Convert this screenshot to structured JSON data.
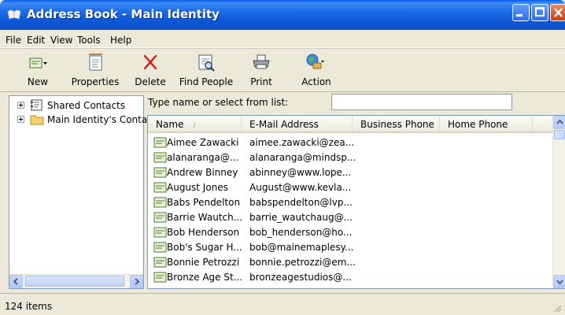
{
  "window": {
    "title": "Address Book - Main Identity"
  },
  "menu": [
    "File",
    "Edit",
    "View",
    "Tools",
    "Help"
  ],
  "toolbar": {
    "new": "New",
    "properties": "Properties",
    "delete": "Delete",
    "find_people": "Find People",
    "print": "Print",
    "action": "Action"
  },
  "tree": {
    "items": [
      {
        "label": "Shared Contacts",
        "icon": "shared-contacts-icon"
      },
      {
        "label": "Main Identity's Conta",
        "icon": "folder-icon"
      }
    ]
  },
  "search": {
    "label": "Type name or select from list:",
    "value": ""
  },
  "list": {
    "columns": [
      "Name",
      "E-Mail Address",
      "Business Phone",
      "Home Phone"
    ],
    "sort_indicator": "/",
    "rows": [
      {
        "name": "Aimee Zawacki",
        "email": "aimee.zawacki@zea..."
      },
      {
        "name": "alanaranga@...",
        "email": "alanaranga@mindsp..."
      },
      {
        "name": "Andrew Binney",
        "email": "abinney@www.lope..."
      },
      {
        "name": "August Jones",
        "email": "August@www.kevla..."
      },
      {
        "name": "Babs Pendelton",
        "email": "babspendelton@lvp..."
      },
      {
        "name": "Barrie Wautch...",
        "email": "barrie_wautchaug@..."
      },
      {
        "name": "Bob Henderson",
        "email": "bob_henderson@ho..."
      },
      {
        "name": "Bob's Sugar H...",
        "email": "bob@mainemaplesy..."
      },
      {
        "name": "Bonnie Petrozzi",
        "email": "bonnie.petrozzi@em..."
      },
      {
        "name": "Bronze Age St...",
        "email": "bronzeagestudios@..."
      }
    ]
  },
  "status": {
    "text": "124 items"
  },
  "colors": {
    "title_bar": "#0c58d6",
    "window_bg": "#ece9d8",
    "close_button": "#c93d12"
  }
}
